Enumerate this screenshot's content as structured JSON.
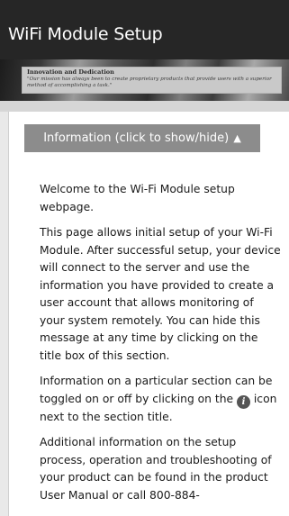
{
  "header": {
    "title": "WiFi Module Setup"
  },
  "banner": {
    "tagline": "Innovation and Dedication",
    "mission": "\"Our mission has always been to create proprietary products that provide users with a superior method of accomplishing a task.\""
  },
  "info_section": {
    "toggle_label": "Information (click to show/hide)",
    "toggle_arrow": "▲",
    "paragraphs": {
      "welcome": "Welcome to the Wi-Fi Module setup webpage.",
      "intro": "This page allows initial setup of your Wi-Fi Module. After successful setup, your device will connect to the server and use the information you have provided to create a user account that allows monitoring of your system remotely. You can hide this message at any time by clicking on the title box of this section.",
      "toggle_before_icon": "Information on a particular section can be toggled on or off by clicking on the ",
      "info_icon_glyph": "i",
      "toggle_after_icon": " icon next to the section title.",
      "additional": "Additional information on the setup process, operation and troubleshooting of your product can be found in the product User Manual or call 800-884-"
    }
  }
}
